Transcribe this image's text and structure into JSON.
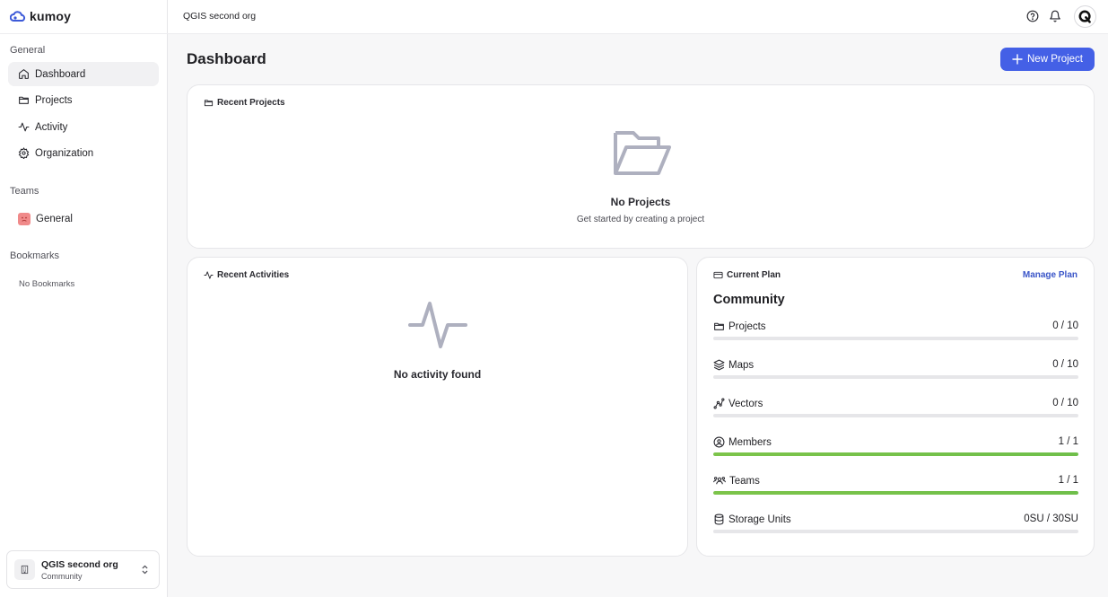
{
  "app": {
    "logo_text": "kumoy",
    "org_title": "QGIS second org"
  },
  "sidebar": {
    "general_label": "General",
    "nav": [
      {
        "label": "Dashboard",
        "icon": "home-icon"
      },
      {
        "label": "Projects",
        "icon": "folder-icon"
      },
      {
        "label": "Activity",
        "icon": "activity-icon"
      },
      {
        "label": "Organization",
        "icon": "gear-icon"
      }
    ],
    "teams_label": "Teams",
    "teams": [
      {
        "label": "General",
        "icon": "team-face-icon"
      }
    ],
    "bookmarks_label": "Bookmarks",
    "no_bookmarks": "No Bookmarks",
    "org_switcher": {
      "name": "QGIS second org",
      "plan": "Community",
      "icon": "building-icon"
    }
  },
  "topbar": {
    "title": "QGIS second org",
    "user_initial": "Q"
  },
  "main": {
    "title": "Dashboard",
    "new_project_label": "New Project",
    "recent_projects": {
      "title": "Recent Projects",
      "empty_title": "No Projects",
      "empty_sub": "Get started by creating a project"
    },
    "recent_activities": {
      "title": "Recent Activities",
      "empty_title": "No activity found"
    },
    "plan": {
      "title": "Current Plan",
      "manage_label": "Manage Plan",
      "name": "Community",
      "usage": [
        {
          "label": "Projects",
          "value": "0 / 10",
          "fraction": 0,
          "icon": "folder-icon"
        },
        {
          "label": "Maps",
          "value": "0 / 10",
          "fraction": 0,
          "icon": "layers-icon"
        },
        {
          "label": "Vectors",
          "value": "0 / 10",
          "fraction": 0,
          "icon": "vector-icon"
        },
        {
          "label": "Members",
          "value": "1 / 1",
          "fraction": 1,
          "icon": "user-circle-icon"
        },
        {
          "label": "Teams",
          "value": "1 / 1",
          "fraction": 1,
          "icon": "users-icon"
        },
        {
          "label": "Storage Units",
          "value": "0SU / 30SU",
          "fraction": 0,
          "icon": "database-icon"
        }
      ]
    }
  },
  "colors": {
    "accent": "#4460e6",
    "usage_full_start": "#7cc44a",
    "usage_full_end": "#6fbf4a",
    "empty_icon": "#aeb0bf"
  }
}
